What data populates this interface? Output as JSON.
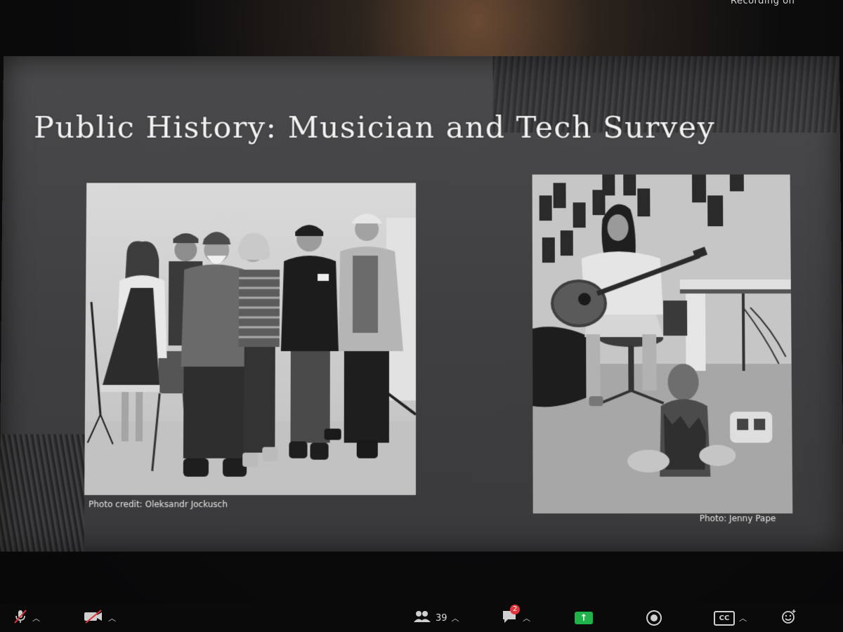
{
  "window": {
    "recording_text": "Recording on"
  },
  "slide": {
    "title": "Public History: Musician and Tech Survey",
    "photo_left_caption": "Photo credit: Oleksandr Jockusch",
    "photo_right_caption": "Photo: Jenny Pape"
  },
  "toolbar": {
    "participants_count": "39",
    "chat_badge": "2",
    "cc_label": "CC",
    "icons": {
      "mute": "microphone-muted-icon",
      "video": "video-off-icon",
      "participants": "participants-icon",
      "chat": "chat-icon",
      "share": "share-screen-icon",
      "record": "record-icon",
      "captions": "captions-icon",
      "reactions": "reactions-icon"
    },
    "accent_green": "#1fb34a",
    "badge_red": "#e0353a"
  }
}
